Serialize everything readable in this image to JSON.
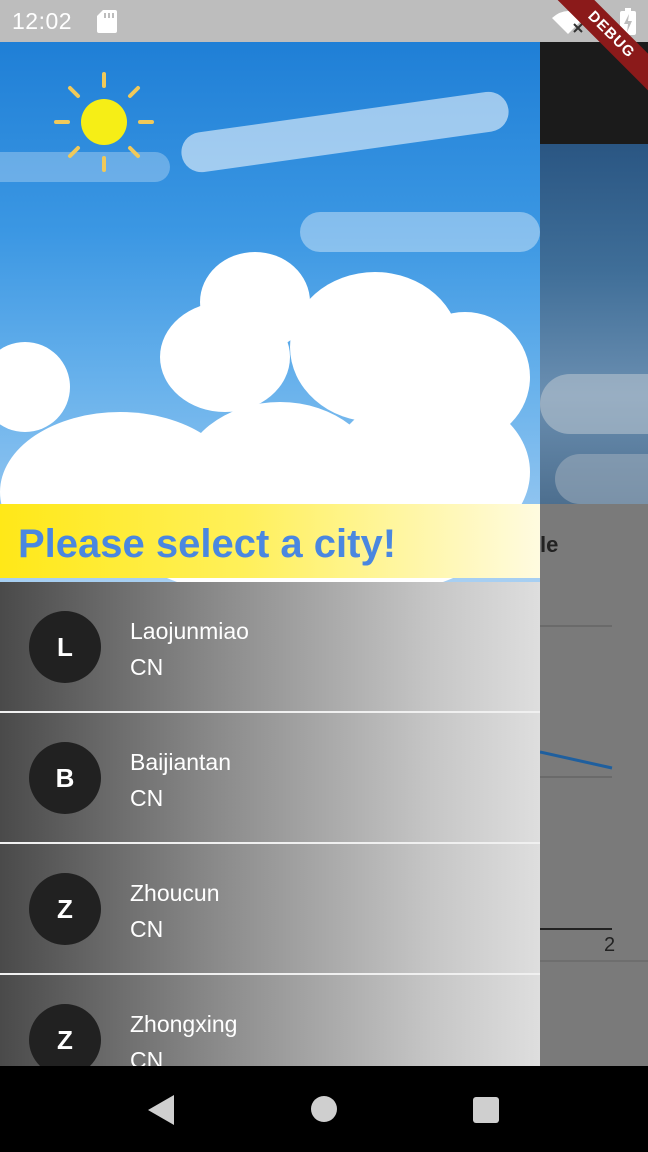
{
  "status_bar": {
    "time": "12:02",
    "icons": [
      "sd-card-icon",
      "wifi-icon",
      "battery-charging-icon"
    ]
  },
  "debug_banner": {
    "label": "DEBUG"
  },
  "drawer": {
    "prompt": "Please select a city!",
    "header_icon": "sun-icon",
    "cities": [
      {
        "initial": "L",
        "name": "Laojunmiao",
        "country": "CN"
      },
      {
        "initial": "B",
        "name": "Baijiantan",
        "country": "CN"
      },
      {
        "initial": "Z",
        "name": "Zhoucun",
        "country": "CN"
      },
      {
        "initial": "Z",
        "name": "Zhongxing",
        "country": "CN"
      }
    ]
  },
  "background_app": {
    "title_fragment": "le",
    "axis_tick_label": "2"
  },
  "nav_bar": {
    "buttons": [
      "back-icon",
      "home-icon",
      "recents-icon"
    ]
  },
  "colors": {
    "prompt_text": "#4a87e0",
    "banner_yellow": "#ffe818",
    "avatar_bg": "#212121",
    "debug_ribbon": "#8b1a1a"
  }
}
